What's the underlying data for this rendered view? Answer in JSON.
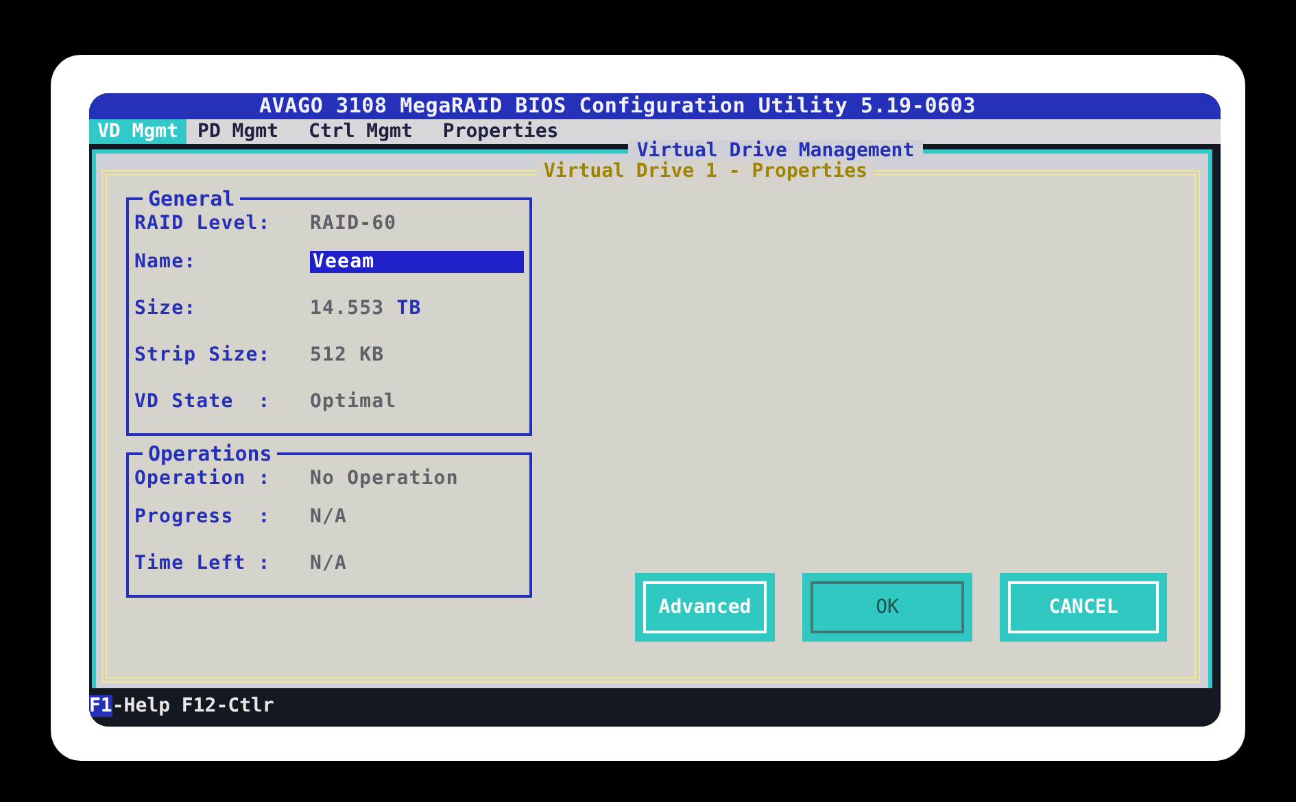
{
  "window": {
    "title": "AVAGO 3108 MegaRAID BIOS Configuration Utility 5.19-0603"
  },
  "tabs": [
    {
      "label": "VD Mgmt",
      "selected": true
    },
    {
      "label": "PD Mgmt",
      "selected": false
    },
    {
      "label": "Ctrl Mgmt",
      "selected": false
    },
    {
      "label": "Properties",
      "selected": false
    }
  ],
  "panel": {
    "title": "Virtual Drive Management"
  },
  "dialog": {
    "title": "Virtual Drive 1 - Properties"
  },
  "groups": [
    {
      "title": "General",
      "rows": [
        {
          "kind": "text",
          "label": "RAID Level:",
          "value": "RAID-60"
        },
        {
          "kind": "field",
          "label": "Name:",
          "value": "Veeam"
        },
        {
          "kind": "text",
          "label": "Size:",
          "value": "14.553 **TB**"
        },
        {
          "kind": "text",
          "label": "Strip Size:",
          "value": "512 KB"
        },
        {
          "kind": "text",
          "label": "VD State  :",
          "value": "Optimal"
        }
      ]
    },
    {
      "title": "Operations",
      "rows": [
        {
          "kind": "text",
          "label": "Operation :",
          "value": "No Operation"
        },
        {
          "kind": "text",
          "label": "Progress  :",
          "value": "N/A"
        },
        {
          "kind": "text",
          "label": "Time Left :",
          "value": "N/A"
        }
      ]
    }
  ],
  "buttons": [
    {
      "label": "Advanced",
      "disabled": false
    },
    {
      "label": "OK",
      "disabled": true
    },
    {
      "label": "CANCEL",
      "disabled": false
    }
  ],
  "status_bar": {
    "key": "F1",
    "text": "-Help F12-Ctlr"
  }
}
